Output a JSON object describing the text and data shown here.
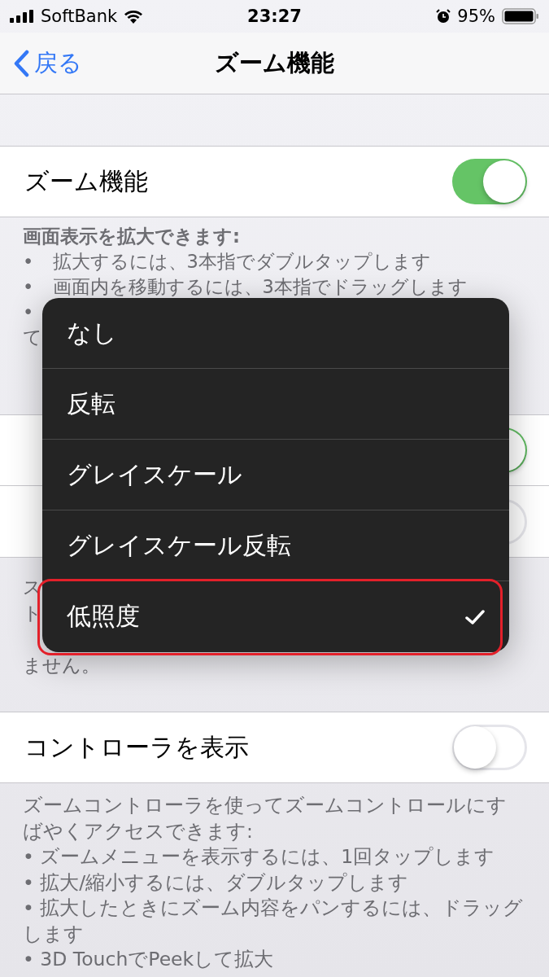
{
  "status_bar": {
    "carrier": "SoftBank",
    "time": "23:27",
    "battery": "95%"
  },
  "nav": {
    "back": "戻る",
    "title": "ズーム機能"
  },
  "zoom_row": {
    "label": "ズーム機能",
    "on": true
  },
  "zoom_footer": {
    "title": "画面表示を拡大できます:",
    "bullets": [
      {
        "bullet": "•",
        "text": "拡大するには、3本指でダブルタップします"
      },
      {
        "bullet": "•",
        "text": "画面内を移動するには、3本指でドラッグします"
      },
      {
        "bullet": "•"
      }
    ],
    "tail": "て"
  },
  "group_rows": [
    {
      "on": true
    },
    {
      "on": false
    }
  ],
  "group_footer": {
    "lines": [
      {
        "left": "ス"
      },
      {
        "left": "ト"
      }
    ],
    "last_line": "ません。"
  },
  "controller_row": {
    "label": "コントローラを表示",
    "on": false
  },
  "controller_footer": {
    "paragraphs": [
      "ズームコントローラを使ってズームコントロールにすばやくアクセスできます:",
      "• ズームメニューを表示するには、1回タップします",
      "• 拡大/縮小するには、ダブルタップします",
      "• 拡大したときにズーム内容をパンするには、ドラッグします",
      "• 3D TouchでPeekして拡大"
    ]
  },
  "filter_menu": {
    "items": [
      {
        "label": "なし",
        "selected": false,
        "highlighted": false
      },
      {
        "label": "反転",
        "selected": false,
        "highlighted": false
      },
      {
        "label": "グレイスケール",
        "selected": false,
        "highlighted": false
      },
      {
        "label": "グレイスケール反転",
        "selected": false,
        "highlighted": false
      },
      {
        "label": "低照度",
        "selected": true,
        "highlighted": true
      }
    ]
  }
}
